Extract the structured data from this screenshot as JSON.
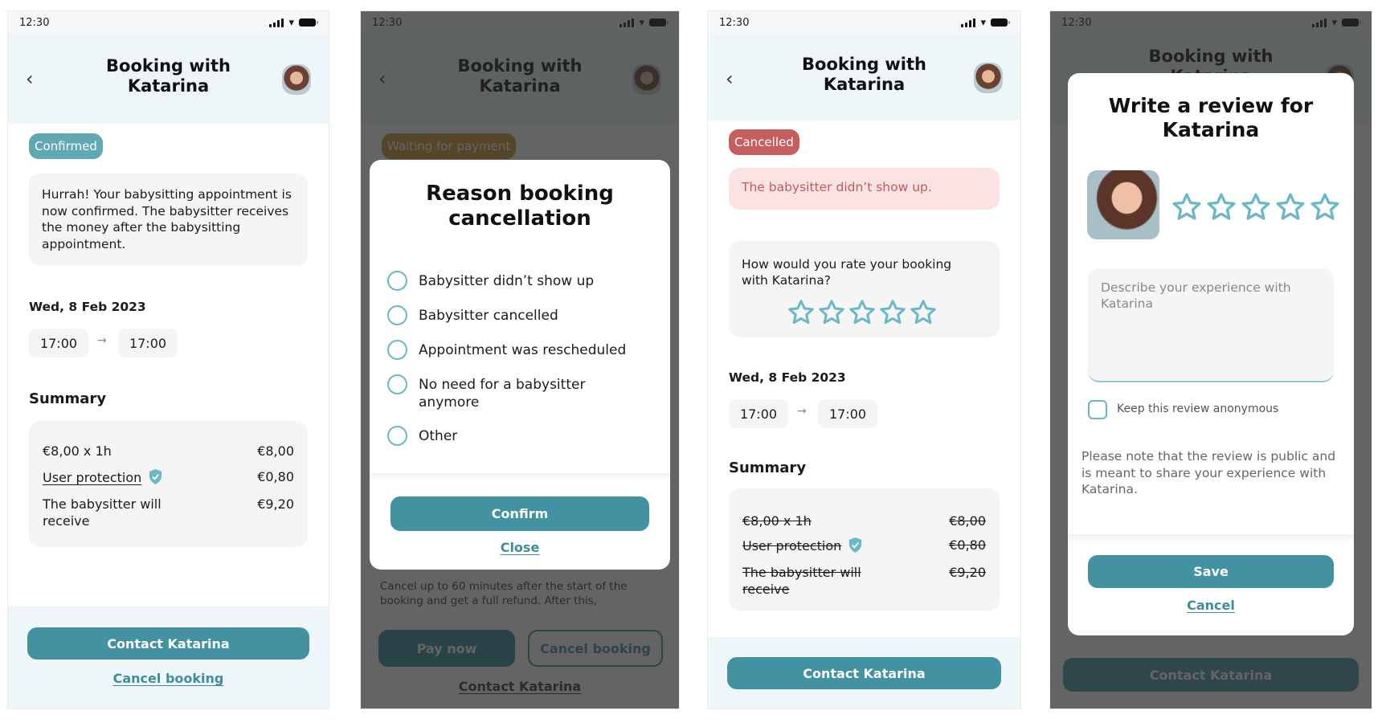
{
  "colors": {
    "primary": "#4292a1",
    "confirmed_badge": "#60a9b2",
    "cancelled_badge": "#c65e5e",
    "waiting_badge": "#8a6a33",
    "cancel_alert_bg": "#fbe3e3",
    "cancel_alert_text": "#c25a5a",
    "star_outline": "#6bb8c6"
  },
  "status_bar": {
    "time": "12:30"
  },
  "header": {
    "title": "Booking with Katarina",
    "back_icon": "chevron-left-icon"
  },
  "screen1": {
    "badge": "Confirmed",
    "message": "Hurrah! Your babysitting appointment is now confirmed. The babysitter receives the money after the babysitting appointment.",
    "date": "Wed, 8 Feb 2023",
    "start_time": "17:00",
    "end_time": "17:00",
    "arrow": "→",
    "summary_title": "Summary",
    "summary_rows": [
      {
        "label": "€8,00 x 1h",
        "value": "€8,00"
      },
      {
        "label": "User protection",
        "value": "€0,80"
      },
      {
        "label": "The babysitter will receive",
        "value": "€9,20"
      }
    ],
    "primary_button": "Contact Katarina",
    "secondary_link": "Cancel booking"
  },
  "screen2": {
    "badge": "Waiting for payment",
    "modal": {
      "title": "Reason booking cancellation",
      "options": [
        "Babysitter didn’t show up",
        "Babysitter cancelled",
        "Appointment was rescheduled",
        "No need for a babysitter anymore",
        "Other"
      ],
      "confirm_button": "Confirm",
      "close_link": "Close"
    },
    "background_text": "Cancel up to 60 minutes after the start of the booking and get a full refund. After this,",
    "pay_button": "Pay now",
    "cancel_button": "Cancel booking",
    "contact_link": "Contact Katarina"
  },
  "screen3": {
    "badge": "Cancelled",
    "alert": "The babysitter didn’t show up.",
    "rating_prompt": "How would you rate your booking with Katarina?",
    "rating_value": 0,
    "rating_max": 5,
    "date": "Wed, 8 Feb 2023",
    "start_time": "17:00",
    "end_time": "17:00",
    "arrow": "→",
    "summary_title": "Summary",
    "summary_rows": [
      {
        "label": "€8,00 x 1h",
        "value": "€8,00"
      },
      {
        "label": "User protection",
        "value": "€0,80"
      },
      {
        "label": "The babysitter will receive",
        "value": "€9,20"
      }
    ],
    "primary_button": "Contact Katarina"
  },
  "screen4": {
    "modal": {
      "title": "Write a review for Katarina",
      "rating_value": 0,
      "rating_max": 5,
      "textarea_placeholder": "Describe your experience with Katarina",
      "anonymous_label": "Keep this review anonymous",
      "anonymous_checked": false,
      "note": "Please note that the review is public and is meant to share your experience with Katarina.",
      "save_button": "Save",
      "cancel_link": "Cancel"
    },
    "background_button": "Contact Katarina"
  }
}
